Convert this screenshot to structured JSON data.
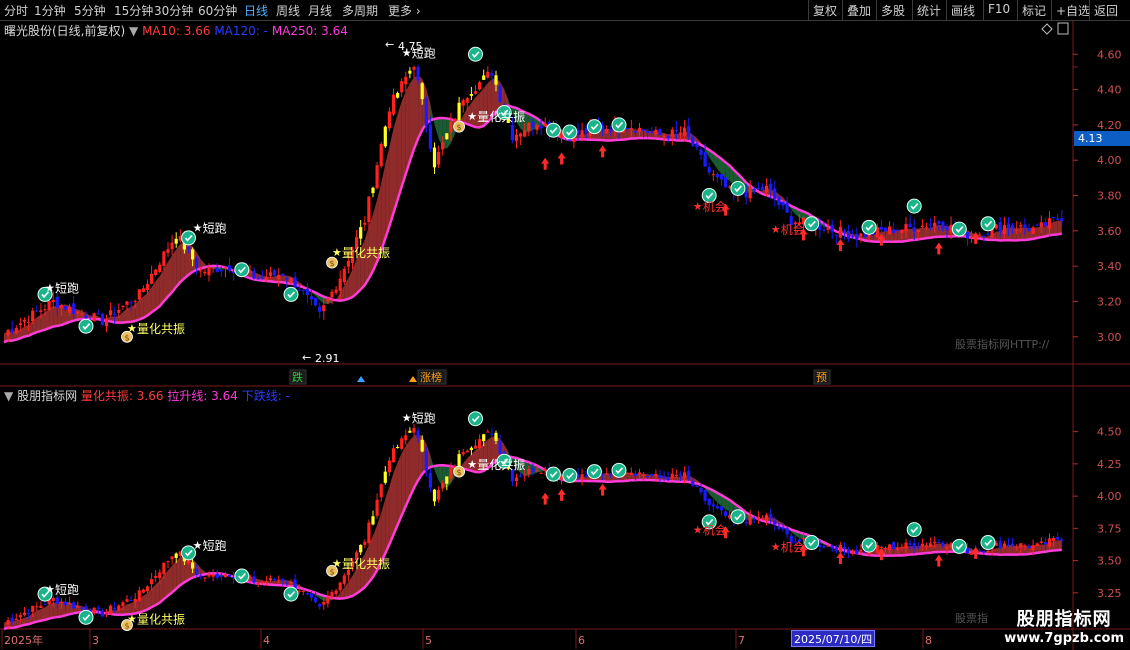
{
  "toolbar": {
    "left_items": [
      "分时",
      "1分钟",
      "5分钟",
      "15分钟",
      "30分钟",
      "60分钟",
      "日线",
      "周线",
      "月线",
      "多周期",
      "更多"
    ],
    "active": "日线",
    "right_items": [
      "复权",
      "叠加",
      "多股",
      "统计",
      "画线",
      "F10",
      "标记",
      "+自选",
      "返回"
    ]
  },
  "main_panel": {
    "title": "曙光股份(日线,前复权)",
    "ma": [
      {
        "label": "MA10: 3.66",
        "color": "#ff3b3b"
      },
      {
        "label": "MA120: -",
        "color": "#2b3bff"
      },
      {
        "label": "MA250: 3.64",
        "color": "#ff3bd8"
      }
    ],
    "price_labels": [
      "4.60",
      "4.40",
      "4.20",
      "4.00",
      "3.80",
      "3.60",
      "3.40",
      "3.20",
      "3.00"
    ],
    "price_tag": "4.13",
    "high_marker": "4.75",
    "low_marker": "2.91",
    "watermark_text": "股票指标网HTTP://",
    "bottom_badges": [
      {
        "text": "跌",
        "color": "#2ecc40"
      },
      {
        "text": "涨榜",
        "color": "#ff9f1a"
      },
      {
        "text": "预",
        "color": "#ff9f1a"
      }
    ]
  },
  "sub_panel": {
    "title": "股朋指标网",
    "items": [
      {
        "label": "量化共振: 3.66",
        "color": "#ff3b3b"
      },
      {
        "label": "拉升线: 3.64",
        "color": "#ff3bd8"
      },
      {
        "label": "下跌线: -",
        "color": "#2b3bff"
      }
    ],
    "price_labels": [
      "4.50",
      "4.25",
      "4.00",
      "3.75",
      "3.50",
      "3.25"
    ],
    "watermark_text": "股票指"
  },
  "annotations": {
    "short_run": "短跑",
    "resonance": "量化共振",
    "opportunity": "机会"
  },
  "date_axis": {
    "labels": [
      "2025年",
      "3",
      "4",
      "5",
      "6",
      "7",
      "8"
    ],
    "selected_date": "2025/07/10/四"
  },
  "site_watermark": {
    "line1": "股朋指标网",
    "line2": "www.7gpzb.com"
  },
  "chart_data": {
    "type": "candlestick",
    "title": "曙光股份(日线,前复权)",
    "ylim": [
      2.88,
      4.76
    ],
    "high": 4.75,
    "low": 2.91,
    "last": 3.66,
    "ma10_last": 3.66,
    "ma250_last": 3.64,
    "x_months": [
      "2025年",
      "3",
      "4",
      "5",
      "6",
      "7",
      "8"
    ]
  },
  "colors": {
    "up": "#ff2020",
    "down": "#1a1aff",
    "flat": "#ffff20",
    "ma250": "#ff3bd8",
    "band_up": "#a83232",
    "band_down": "#1e6b3a",
    "grid": "#7a1a1a"
  }
}
